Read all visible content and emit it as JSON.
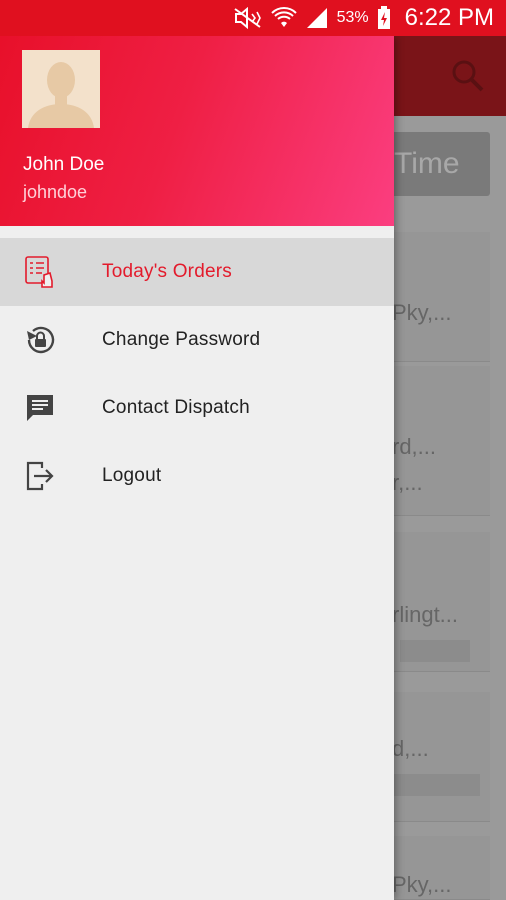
{
  "status_bar": {
    "battery_percent": "53%",
    "time": "6:22 PM",
    "icons": [
      "mute-icon",
      "wifi-icon",
      "signal-icon",
      "battery-charging-icon"
    ]
  },
  "background": {
    "tab_fragment": "Time",
    "card_fragments": [
      "Pky,...",
      "rd,...",
      "r,...",
      "rlingt...",
      "d,...",
      "Pky,..."
    ]
  },
  "drawer": {
    "user": {
      "name": "John Doe",
      "username": "johndoe"
    },
    "menu": [
      {
        "label": "Today's Orders",
        "icon": "orders-list-icon",
        "active": true
      },
      {
        "label": "Change Password",
        "icon": "lock-reset-icon",
        "active": false
      },
      {
        "label": "Contact Dispatch",
        "icon": "message-icon",
        "active": false
      },
      {
        "label": "Logout",
        "icon": "logout-icon",
        "active": false
      }
    ]
  },
  "colors": {
    "accent": "#e31b2c",
    "header_gradient_start": "#e8102a",
    "header_gradient_end": "#fb3e80"
  }
}
